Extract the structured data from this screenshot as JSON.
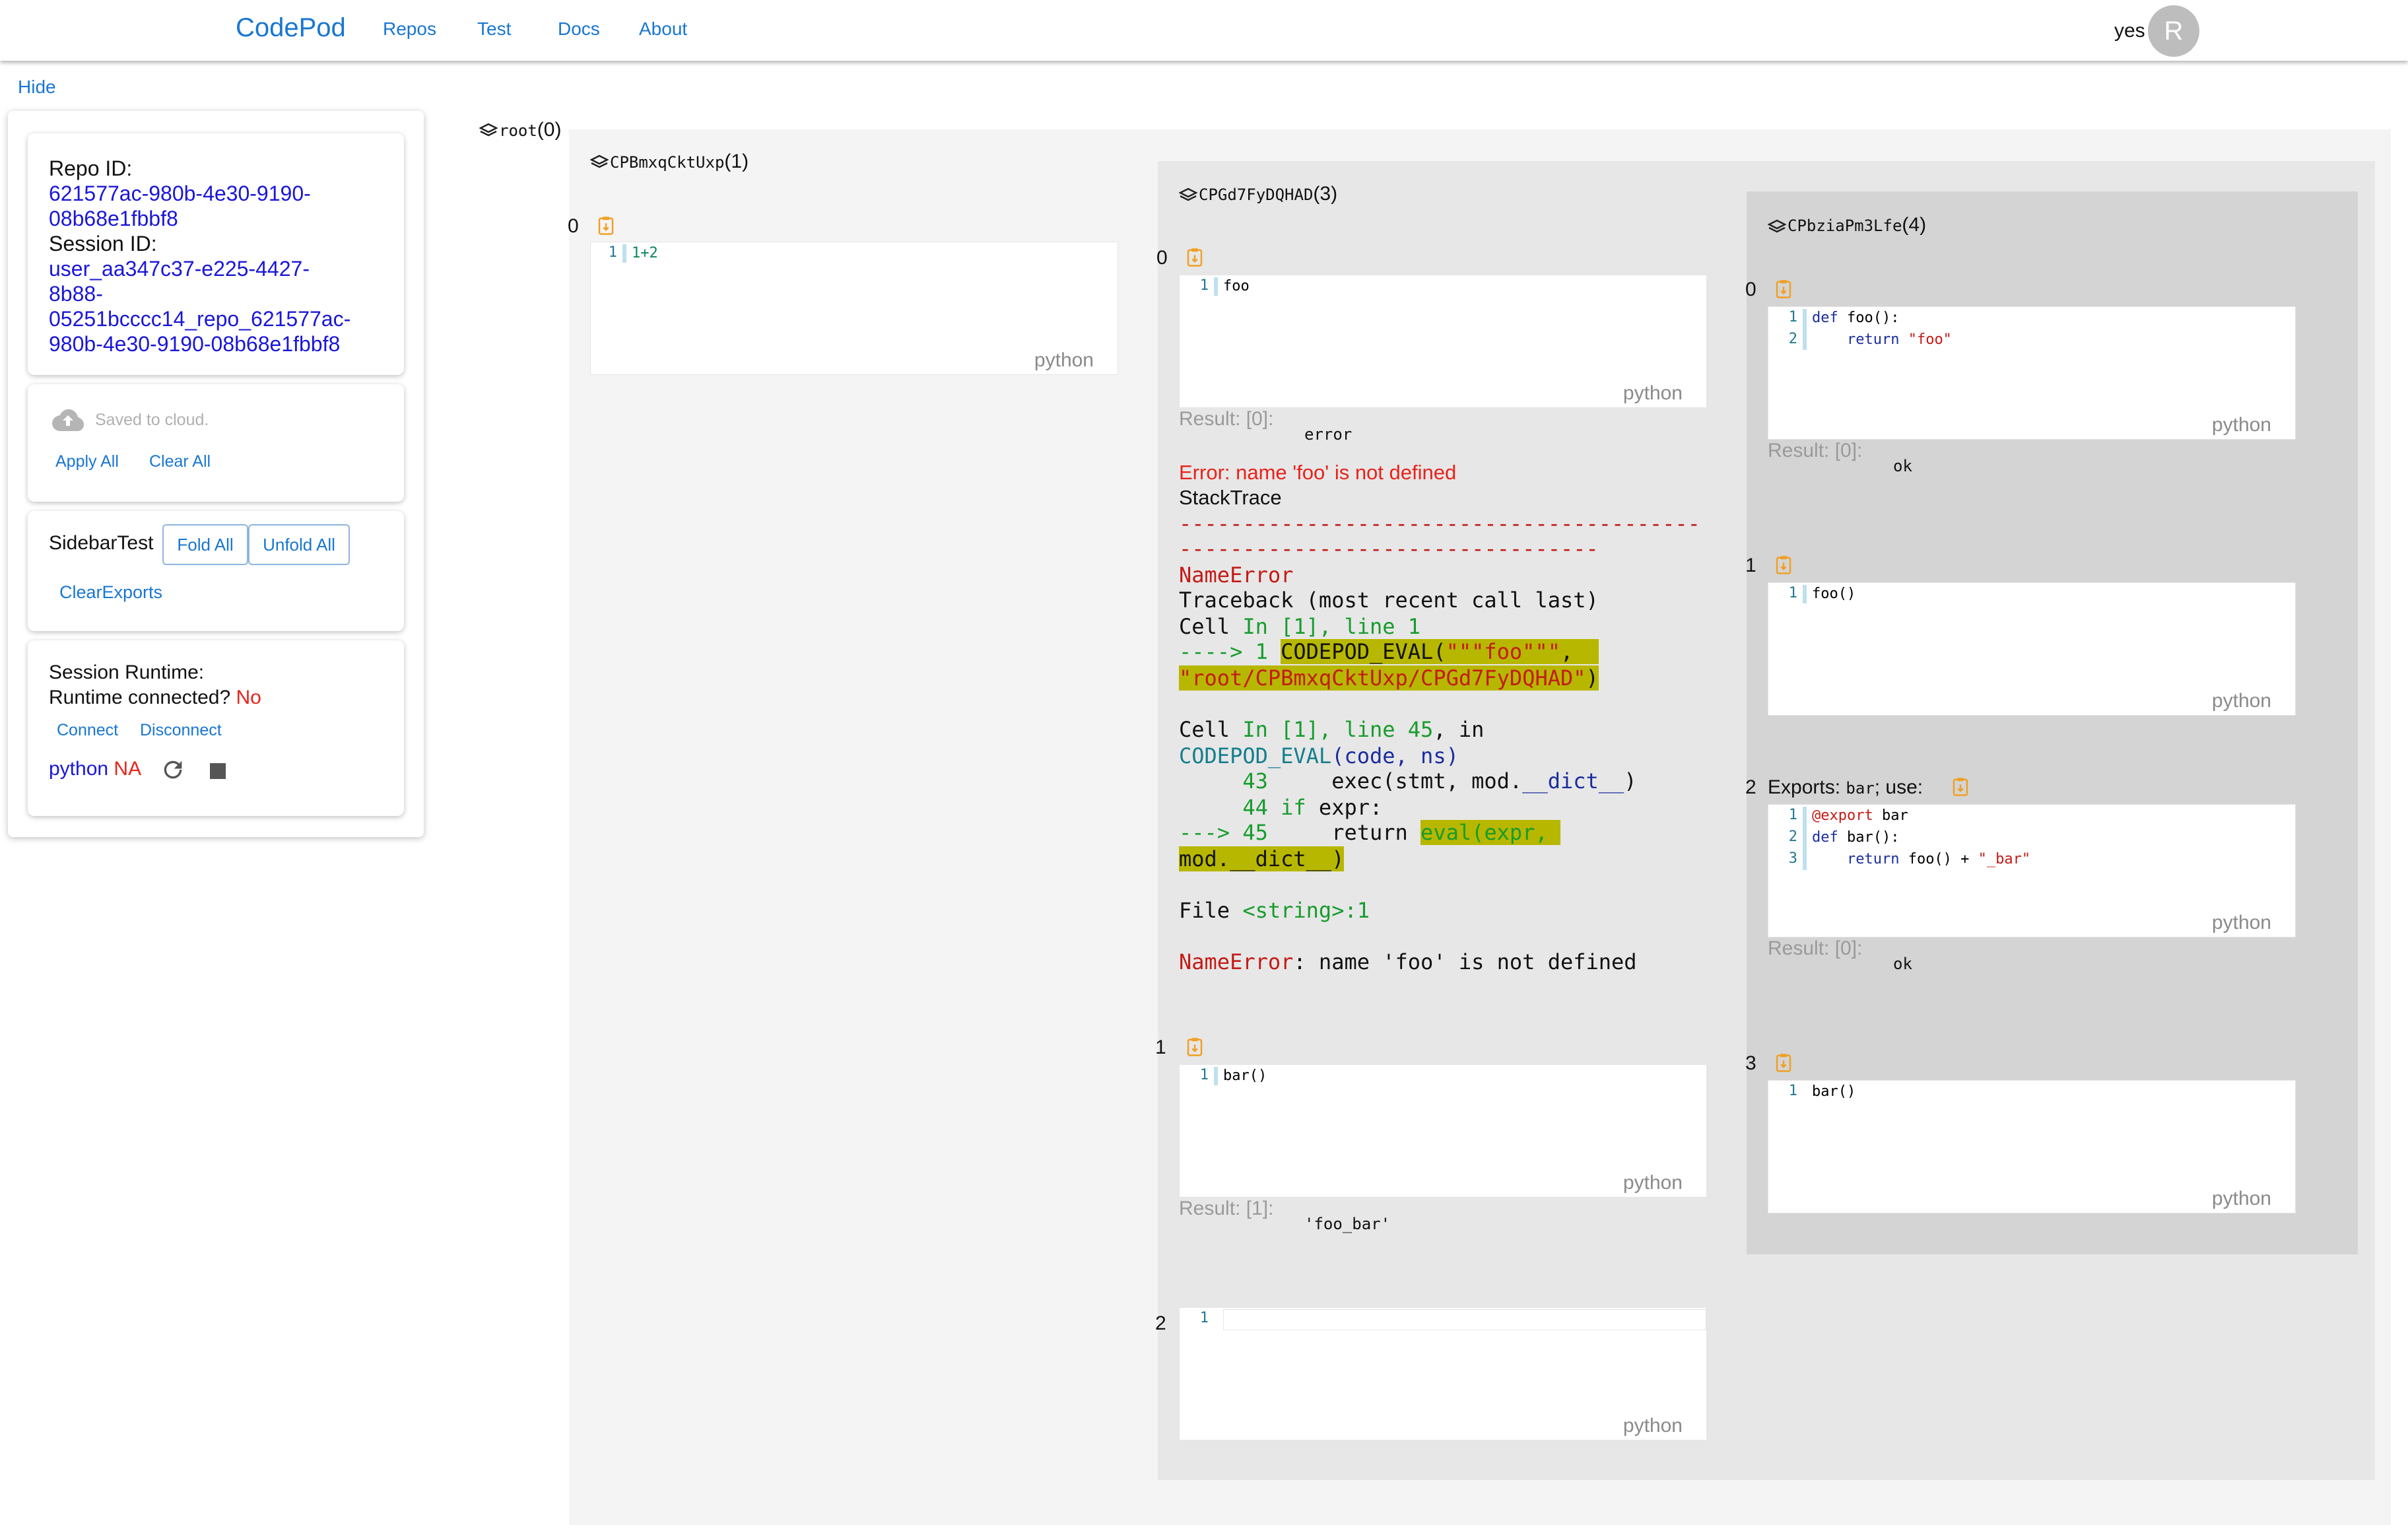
{
  "nav": {
    "brand": "CodePod",
    "links": [
      "Repos",
      "Test",
      "Docs",
      "About"
    ],
    "user_name": "yes",
    "avatar_letter": "R"
  },
  "sidebar": {
    "hide_label": "Hide",
    "repo_id_label": "Repo ID:",
    "repo_id_lines": [
      "621577ac-980b-4e30-9190-",
      "08b68e1fbbf8"
    ],
    "session_id_label": "Session ID:",
    "session_id_lines": [
      "user_aa347c37-e225-4427-",
      "8b88-",
      "05251bcccc14_repo_621577ac-",
      "980b-4e30-9190-08b68e1fbbf8"
    ],
    "saved_text": "Saved to cloud.",
    "apply_all": "Apply All",
    "clear_all": "Clear All",
    "sidebar_test": "SidebarTest",
    "fold_all": "Fold All",
    "unfold_all": "Unfold All",
    "clear_exports": "ClearExports",
    "session_runtime": "Session Runtime:",
    "runtime_connected": "Runtime connected?",
    "runtime_connected_value": "No",
    "connect": "Connect",
    "disconnect": "Disconnect",
    "kernel_name": "python",
    "kernel_status": "NA"
  },
  "canvas": {
    "root_title": "root",
    "root_count": "(0)",
    "deck1_title": "CPBmxqCktUxp",
    "deck1_count": "(1)",
    "deck2_title": "CPGd7FyDQHAD",
    "deck2_count": "(3)",
    "deck3_title": "CPbziaPm3Lfe",
    "deck3_count": "(4)",
    "lang": "python",
    "pod_a": {
      "index": "0",
      "line_no": "1",
      "code": "1+2"
    },
    "pod_b0": {
      "index": "0",
      "line_no": "1",
      "code": "foo",
      "result_label": "Result: [0]:",
      "result_value": "error",
      "error_msg": "Error: name 'foo' is not defined",
      "stacktrace_label": "StackTrace",
      "dashes1": "-----------------------------------------",
      "dashes2": "---------------------------------",
      "tb_name_error": "NameError",
      "tb_traceback": "Traceback (most recent call last)",
      "tb_cell": "Cell ",
      "tb_in1": "In [1], line 1",
      "tb_arrow1": "----> 1 ",
      "tb_eval": "CODEPOD_EVAL(",
      "tb_str1": "\"\"\"foo\"\"\"",
      "tb_comma": ",",
      "tb_str2": "\"root/CPBmxqCktUxp/CPGd7FyDQHAD\"",
      "tb_close": ")",
      "tb_cell2": "Cell ",
      "tb_in2": "In [1], line 45",
      "tb_in2_after": ", in",
      "tb_fn": "CODEPOD_EVAL",
      "tb_args": "(code, ns)",
      "tb_l43_no": "     43 ",
      "tb_l43": "    exec(stmt, mod.",
      "tb_l43_dict": "__dict__",
      "tb_l43_close": ")",
      "tb_l44_no": "     44 ",
      "tb_l44_if": "if",
      "tb_l44": " expr:",
      "tb_arrow45": "---> 45 ",
      "tb_l45": "    return ",
      "tb_l45_eval": "eval(expr, ",
      "tb_l45_mod": "mod.__dict__)",
      "tb_file": "File ",
      "tb_file_str": "<string>:1",
      "tb_final_name": "NameError",
      "tb_final_msg": ": name 'foo' is not defined"
    },
    "pod_b1": {
      "index": "1",
      "line_no": "1",
      "code": "bar()",
      "result_label": "Result: [1]:",
      "result_value": "'foo_bar'"
    },
    "pod_b2": {
      "index": "2",
      "line_no": "1",
      "code": ""
    },
    "pod_c0": {
      "index": "0",
      "line1_no": "1",
      "line1_kw": "def",
      "line1_rest": " foo():",
      "line2_no": "2",
      "line2_kw": "    return ",
      "line2_str": "\"foo\"",
      "result_label": "Result: [0]:",
      "result_value": "ok"
    },
    "pod_c1": {
      "index": "1",
      "line_no": "1",
      "code": "foo()"
    },
    "pod_c2": {
      "index": "2",
      "exports_label": "Exports:",
      "exports_value": "bar",
      "use_label": "; use:",
      "line1_no": "1",
      "line1_dec": "@export",
      "line1_rest": " bar",
      "line2_no": "2",
      "line2_kw": "def",
      "line2_rest": " bar():",
      "line3_no": "3",
      "line3_kw": "    return",
      "line3_rest": " foo() + ",
      "line3_str": "\"_bar\"",
      "result_label": "Result: [0]:",
      "result_value": "ok"
    },
    "pod_c3": {
      "index": "3",
      "line_no": "1",
      "code": "bar()"
    }
  },
  "colors": {
    "accent": "#1976d2",
    "error": "#e8231a",
    "deck2_bg": "#e7e7e7",
    "deck3_bg": "#d4d4d4",
    "clipboard": "#f0a024"
  }
}
